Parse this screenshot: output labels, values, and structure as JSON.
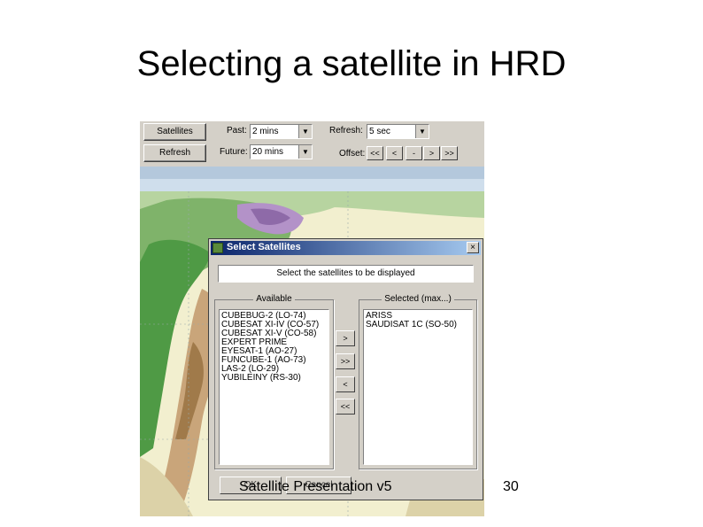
{
  "slide": {
    "title": "Selecting a satellite in HRD",
    "footer": "Satellite Presentation v5",
    "page_number": "30"
  },
  "toolbar": {
    "satellites_button": "Satellites",
    "refresh_button": "Refresh",
    "past_label": "Past:",
    "past_value": "2 mins",
    "future_label": "Future:",
    "future_value": "20 mins",
    "refresh_label": "Refresh:",
    "refresh_value": "5 sec",
    "offset_label": "Offset:",
    "offset_buttons": [
      "<<",
      "<",
      "-",
      ">",
      ">>"
    ]
  },
  "dialog": {
    "title": "Select Satellites",
    "message": "Select the satellites to be displayed",
    "available_label": "Available",
    "selected_label": "Selected (max...)",
    "available": [
      "CUBEBUG-2 (LO-74)",
      "CUBESAT XI-IV (CO-57)",
      "CUBESAT XI-V (CO-58)",
      "EXPERT PRIME",
      "EYESAT-1 (AO-27)",
      "FUNCUBE-1 (AO-73)",
      "LAS-2 (LO-29)",
      "YUBILEINY (RS-30)"
    ],
    "selected": [
      "ARISS",
      "SAUDISAT 1C (SO-50)"
    ],
    "move_buttons": [
      ">",
      ">>",
      "<",
      "<<"
    ],
    "ok_button": "OK",
    "cancel_button": "Cancel",
    "close_glyph": "×"
  },
  "colors": {
    "titlebar_start": "#0a246a",
    "titlebar_end": "#a6caf0",
    "window_gray": "#d4d0c8",
    "map_land": "#f2efcf"
  }
}
